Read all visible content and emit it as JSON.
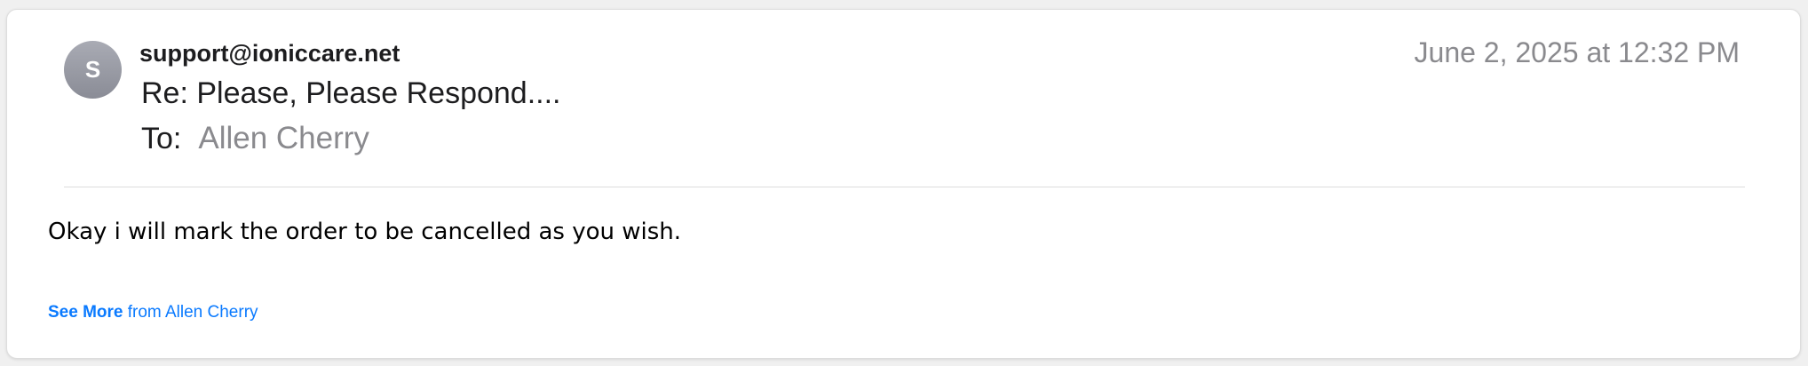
{
  "email": {
    "avatar_initial": "S",
    "sender": "support@ioniccare.net",
    "subject": "Re: Please, Please Respond....",
    "to_label": "To:",
    "to_value": "Allen Cherry",
    "date": "June 2, 2025 at 12:32 PM",
    "body": "Okay i will mark the order to be cancelled as you wish.",
    "see_more_bold": "See More",
    "see_more_rest": " from Allen Cherry"
  },
  "colors": {
    "accent": "#0a7aff",
    "secondary_text": "#8a8a8e",
    "avatar": "#9b9da6"
  }
}
